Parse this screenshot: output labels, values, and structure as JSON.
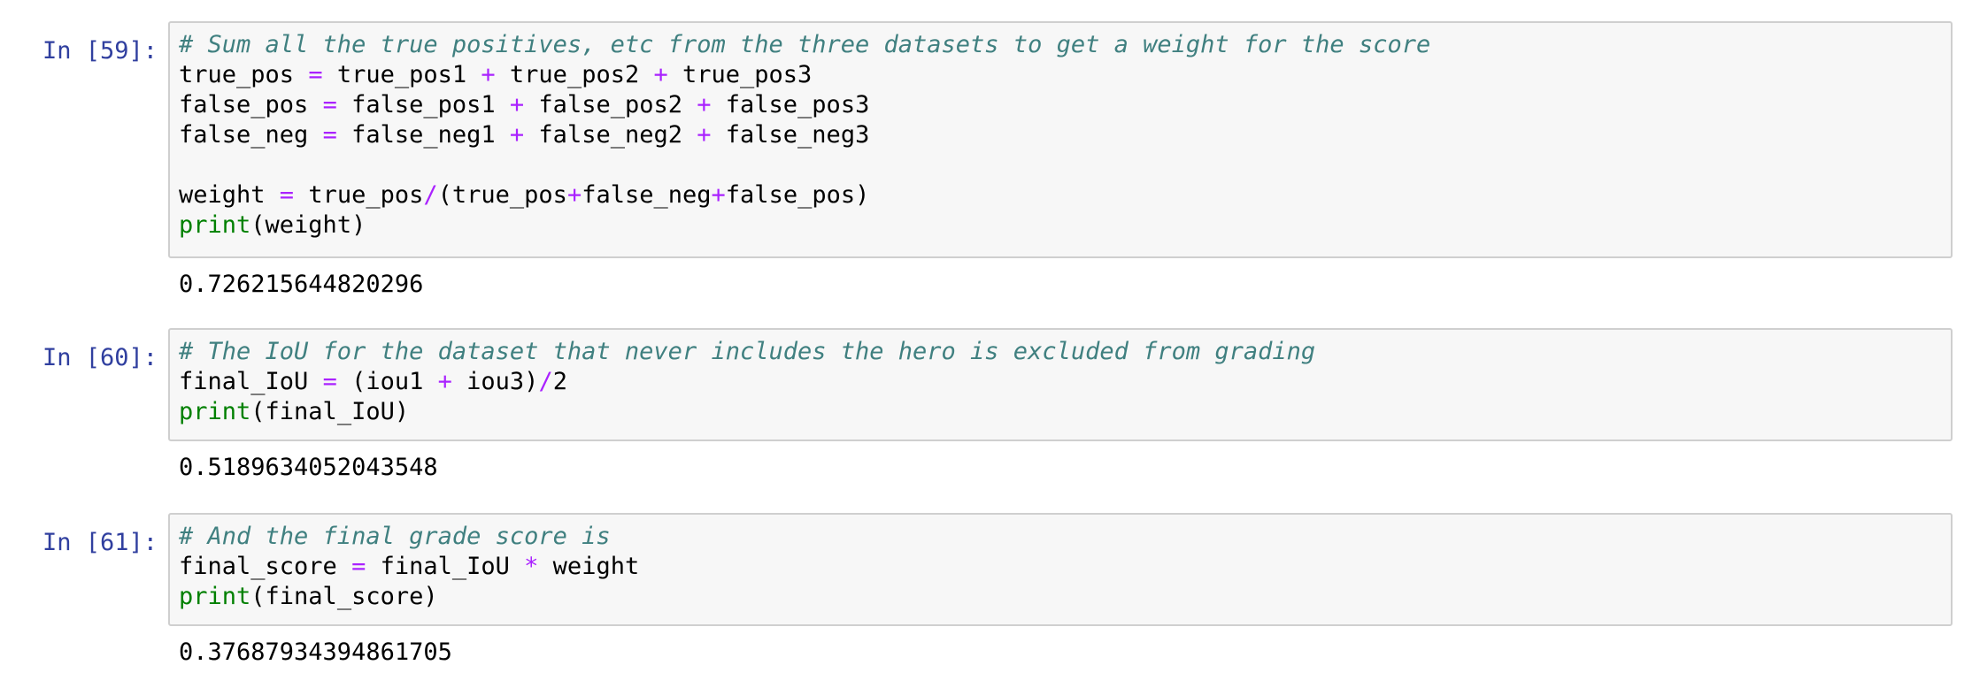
{
  "cells": [
    {
      "prompt": "In [59]:",
      "lines": [
        {
          "comment": "# Sum all the true positives, etc from the three datasets to get a weight for the score"
        },
        {
          "parts": [
            "true_pos ",
            "=",
            " true_pos1 ",
            "+",
            " true_pos2 ",
            "+",
            " true_pos3"
          ]
        },
        {
          "parts": [
            "false_pos ",
            "=",
            " false_pos1 ",
            "+",
            " false_pos2 ",
            "+",
            " false_pos3"
          ]
        },
        {
          "parts": [
            "false_neg ",
            "=",
            " false_neg1 ",
            "+",
            " false_neg2 ",
            "+",
            " false_neg3"
          ]
        },
        {
          "blank": ""
        },
        {
          "parts": [
            "weight ",
            "=",
            " true_pos",
            "/",
            "(true_pos",
            "+",
            "false_neg",
            "+",
            "false_pos)"
          ]
        },
        {
          "builtin": "print",
          "rest": "(weight)"
        }
      ],
      "output": "0.726215644820296"
    },
    {
      "prompt": "In [60]:",
      "lines": [
        {
          "comment": "# The IoU for the dataset that never includes the hero is excluded from grading"
        },
        {
          "parts": [
            "final_IoU ",
            "=",
            " (iou1 ",
            "+",
            " iou3)",
            "/",
            "2"
          ]
        },
        {
          "builtin": "print",
          "rest": "(final_IoU)"
        }
      ],
      "output": "0.5189634052043548"
    },
    {
      "prompt": "In [61]:",
      "lines": [
        {
          "comment": "# And the final grade score is"
        },
        {
          "parts": [
            "final_score ",
            "=",
            " final_IoU ",
            "*",
            " weight"
          ]
        },
        {
          "builtin": "print",
          "rest": "(final_score)"
        }
      ],
      "output": "0.37687934394861705"
    }
  ]
}
